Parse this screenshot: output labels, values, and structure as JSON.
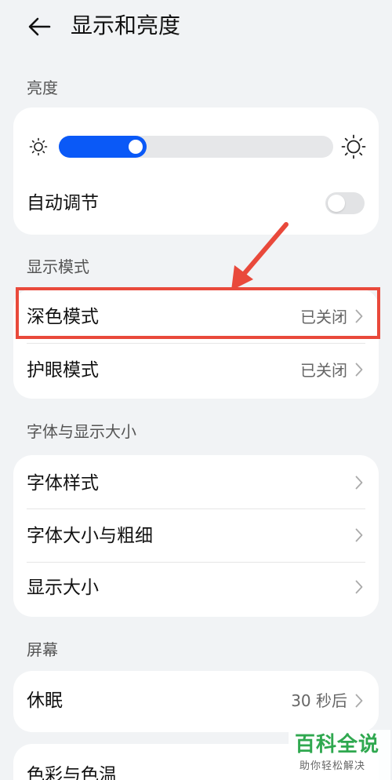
{
  "header": {
    "title": "显示和亮度",
    "back_icon": "arrow-left-icon"
  },
  "sections": {
    "brightness": {
      "label": "亮度",
      "level_percent": 32,
      "auto_label": "自动调节",
      "auto_enabled": false
    },
    "display_mode": {
      "label": "显示模式",
      "items": [
        {
          "title": "深色模式",
          "value": "已关闭"
        },
        {
          "title": "护眼模式",
          "value": "已关闭"
        }
      ]
    },
    "font": {
      "label": "字体与显示大小",
      "items": [
        {
          "title": "字体样式"
        },
        {
          "title": "字体大小与粗细"
        },
        {
          "title": "显示大小"
        }
      ]
    },
    "screen": {
      "label": "屏幕",
      "items": [
        {
          "title": "休眠",
          "value": "30 秒后"
        }
      ],
      "partial_item": {
        "title": "色彩与色温"
      }
    }
  },
  "watermark": {
    "title": "百科全说",
    "subtitle": "助你轻松解决"
  },
  "colors": {
    "accent": "#0a59f7",
    "highlight": "#e9493b",
    "watermark": "#2fa84f"
  }
}
